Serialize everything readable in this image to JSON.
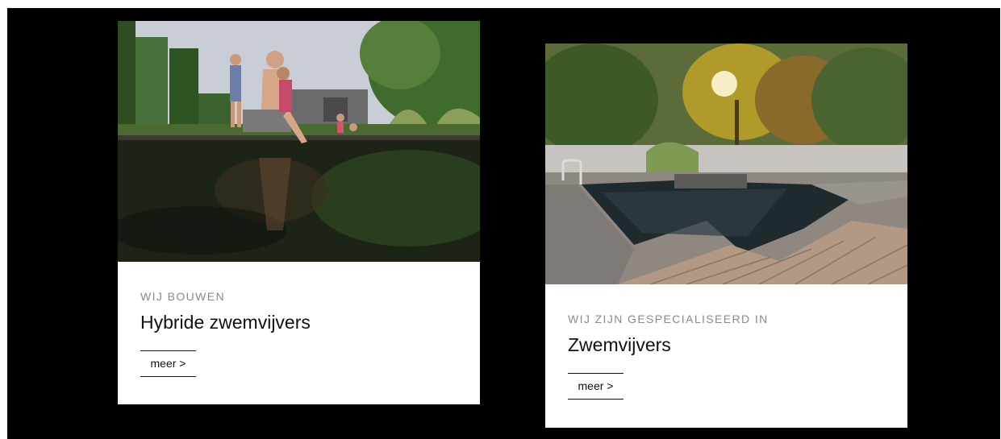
{
  "cards": [
    {
      "eyebrow": "WIJ BOUWEN",
      "title": "Hybride zwemvijvers",
      "button_label": "meer >",
      "image_subject": "people-at-natural-pool-photo"
    },
    {
      "eyebrow": "WIJ ZIJN GESPECIALISEERD IN",
      "title": "Zwemvijvers",
      "button_label": "meer >",
      "image_subject": "pool-with-wooden-deck-photo"
    }
  ],
  "colors": {
    "background": "#000000",
    "card": "#ffffff",
    "eyebrow": "#8a8a8a",
    "text": "#111111"
  }
}
